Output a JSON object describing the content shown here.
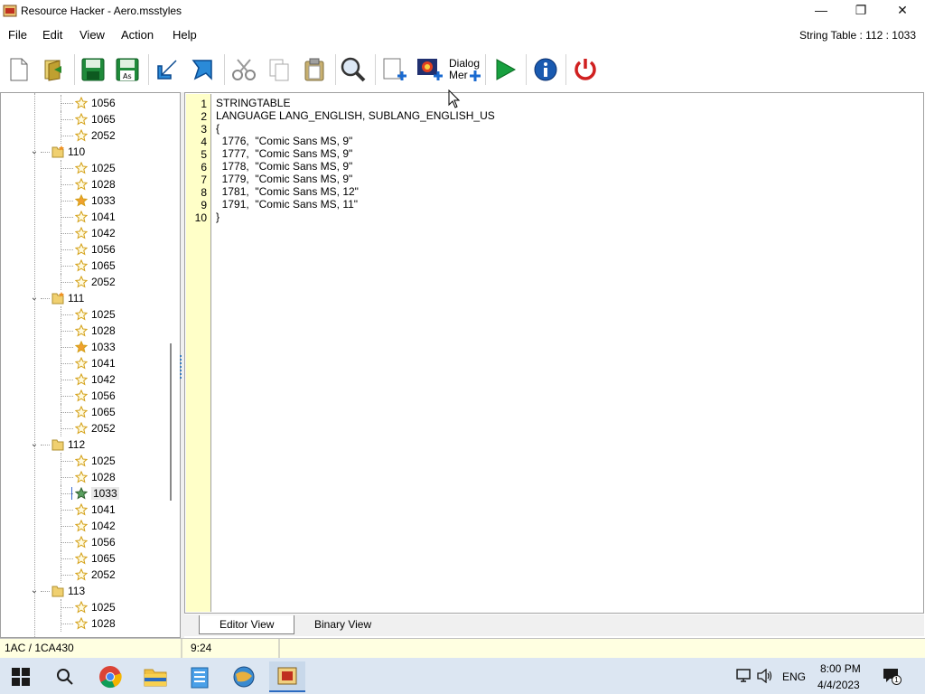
{
  "window": {
    "title": "Resource Hacker - Aero.msstyles",
    "minimize_glyph": "—",
    "maximize_glyph": "❐",
    "close_glyph": "✕"
  },
  "menu": {
    "items": [
      "File",
      "Edit",
      "View",
      "Action",
      "Help"
    ],
    "info": "String Table : 112 : 1033"
  },
  "toolbar": {
    "dialog_menu_line1": "Dialog",
    "dialog_menu_line2": "Mer"
  },
  "tree": {
    "rows": [
      {
        "label": "1056",
        "kind": "star"
      },
      {
        "label": "1065",
        "kind": "star"
      },
      {
        "label": "2052",
        "kind": "star"
      },
      {
        "label": "110",
        "kind": "folder-star",
        "expanded": true
      },
      {
        "label": "1025",
        "kind": "star"
      },
      {
        "label": "1028",
        "kind": "star"
      },
      {
        "label": "1033",
        "kind": "star-filled"
      },
      {
        "label": "1041",
        "kind": "star"
      },
      {
        "label": "1042",
        "kind": "star"
      },
      {
        "label": "1056",
        "kind": "star"
      },
      {
        "label": "1065",
        "kind": "star"
      },
      {
        "label": "2052",
        "kind": "star"
      },
      {
        "label": "111",
        "kind": "folder-star",
        "expanded": true
      },
      {
        "label": "1025",
        "kind": "star"
      },
      {
        "label": "1028",
        "kind": "star"
      },
      {
        "label": "1033",
        "kind": "star-filled"
      },
      {
        "label": "1041",
        "kind": "star"
      },
      {
        "label": "1042",
        "kind": "star"
      },
      {
        "label": "1056",
        "kind": "star"
      },
      {
        "label": "1065",
        "kind": "star"
      },
      {
        "label": "2052",
        "kind": "star"
      },
      {
        "label": "112",
        "kind": "folder",
        "expanded": true
      },
      {
        "label": "1025",
        "kind": "star"
      },
      {
        "label": "1028",
        "kind": "star"
      },
      {
        "label": "1033",
        "kind": "star-selected"
      },
      {
        "label": "1041",
        "kind": "star"
      },
      {
        "label": "1042",
        "kind": "star"
      },
      {
        "label": "1056",
        "kind": "star"
      },
      {
        "label": "1065",
        "kind": "star"
      },
      {
        "label": "2052",
        "kind": "star"
      },
      {
        "label": "113",
        "kind": "folder",
        "expanded": true
      },
      {
        "label": "1025",
        "kind": "star"
      },
      {
        "label": "1028",
        "kind": "star"
      }
    ]
  },
  "editor": {
    "line_numbers": [
      "1",
      "2",
      "3",
      "4",
      "5",
      "6",
      "7",
      "8",
      "9",
      "10"
    ],
    "lines": [
      "STRINGTABLE",
      "LANGUAGE LANG_ENGLISH, SUBLANG_ENGLISH_US",
      "{",
      "  1776,  \"Comic Sans MS, 9\"",
      "  1777,  \"Comic Sans MS, 9\"",
      "  1778,  \"Comic Sans MS, 9\"",
      "  1779,  \"Comic Sans MS, 9\"",
      "  1781,  \"Comic Sans MS, 12\"",
      "  1791,  \"Comic Sans MS, 11\"",
      "}"
    ]
  },
  "tabs": {
    "editor_view": "Editor View",
    "binary_view": "Binary View"
  },
  "status": {
    "offset": "1AC / 1CA430",
    "cursor_pos": "9:24"
  },
  "taskbar": {
    "lang": "ENG",
    "time": "8:00 PM",
    "date": "4/4/2023",
    "notif_count": "1"
  },
  "colors": {
    "star_outline": "#d4a017",
    "star_filled": "#f0a030",
    "gutter": "#ffffc8",
    "status_bg": "#ffffe1",
    "taskbar_bg": "#dce6f2"
  }
}
